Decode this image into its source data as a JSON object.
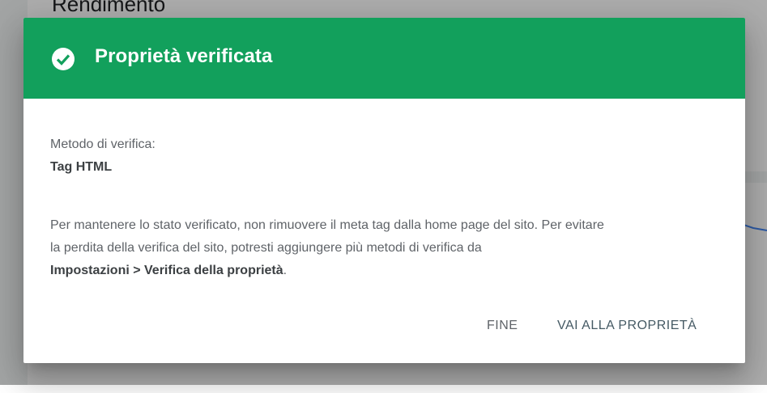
{
  "background": {
    "section_title": "Rendimento"
  },
  "dialog": {
    "title": "Proprietà verificata",
    "header_color": "#12a05c",
    "icon": "check-circle-icon",
    "method_label": "Metodo di verifica:",
    "method_value": "Tag HTML",
    "info_text_line1": "Per mantenere lo stato verificato, non rimuovere il meta tag dalla home page del sito. Per evitare",
    "info_text_line2": "la perdita della verifica del sito, potresti aggiungere più metodi di verifica da",
    "info_text_strong": "Impostazioni > Verifica della proprietà",
    "info_text_end": ".",
    "buttons": {
      "done_label": "FINE",
      "go_label": "VAI ALLA PROPRIETÀ"
    }
  }
}
